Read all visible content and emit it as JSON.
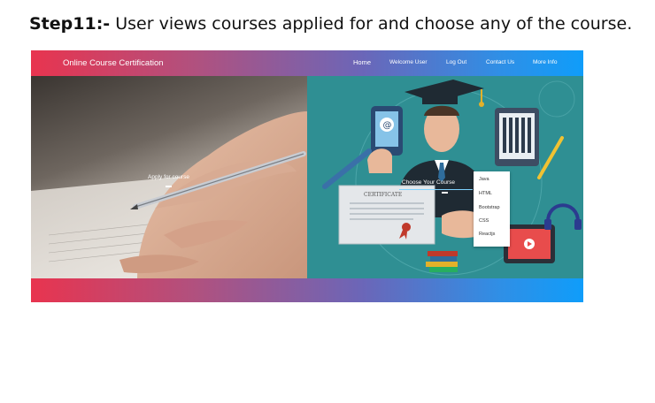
{
  "doc": {
    "step_label": "Step11:-",
    "step_text": " User views courses applied for and choose any of the course."
  },
  "app": {
    "brand": "Online Course Certification",
    "nav": {
      "home": "Home",
      "welcome": "Welcome User",
      "logout": "Log Out",
      "contact": "Contact Us",
      "more": "More Info"
    },
    "left_panel": {
      "caption": "Apply for course"
    },
    "right_panel": {
      "caption": "Choose Your Course",
      "certificate_text": "CERTIFICATE",
      "email_glyph": "@"
    },
    "course_menu": [
      "Java",
      "HTML",
      "Bootstrap",
      "CSS",
      "Reactjs"
    ]
  },
  "colors": {
    "gradient_start": "#e8344f",
    "gradient_end": "#0f9dfa",
    "teal_panel": "#2f8f93"
  }
}
